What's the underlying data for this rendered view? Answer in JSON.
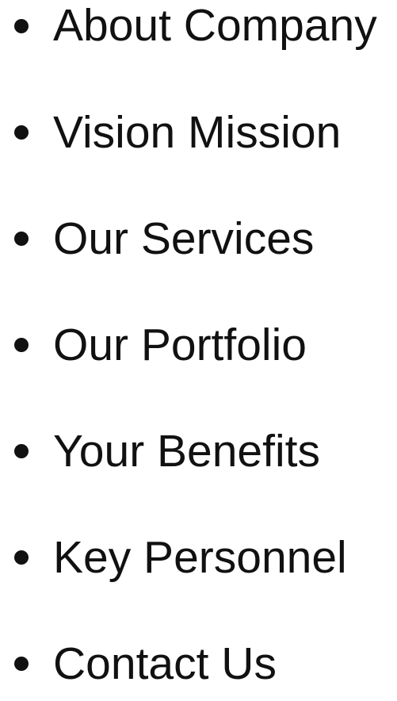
{
  "nav": {
    "items": [
      {
        "label": "About Company"
      },
      {
        "label": "Vision Mission"
      },
      {
        "label": "Our Services"
      },
      {
        "label": "Our Portfolio"
      },
      {
        "label": "Your Benefits"
      },
      {
        "label": "Key Personnel"
      },
      {
        "label": "Contact Us"
      }
    ]
  },
  "colors": {
    "text": "#111111",
    "background": "#ffffff"
  }
}
